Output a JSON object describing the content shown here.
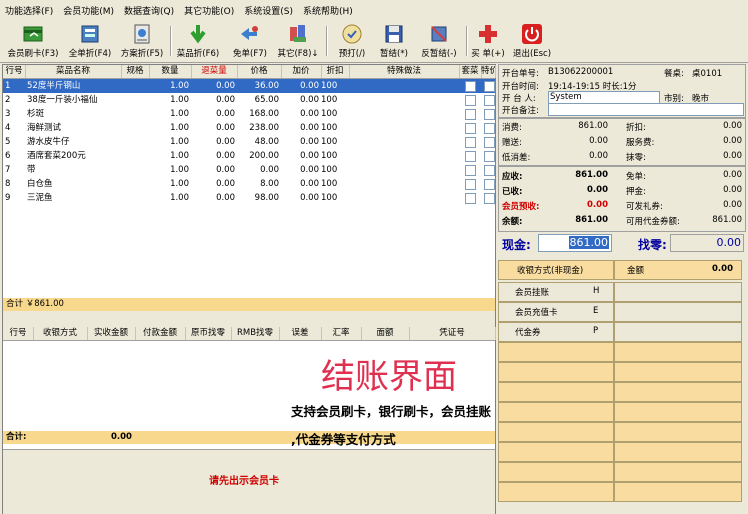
{
  "menu": [
    "功能选择(F)",
    "会员功能(M)",
    "数据查询(Q)",
    "其它功能(O)",
    "系统设置(S)",
    "系统帮助(H)"
  ],
  "toolbar": [
    {
      "label": "会员刷卡(F3)",
      "icon": "member-card-icon"
    },
    {
      "label": "全单折(F4)",
      "icon": "discount-all-icon"
    },
    {
      "label": "方案折(F5)",
      "icon": "plan-discount-icon"
    },
    {
      "label": "菜品折(F6)",
      "icon": "dish-discount-icon"
    },
    {
      "label": "免单(F7)",
      "icon": "free-order-icon"
    },
    {
      "label": "其它(F8)↓",
      "icon": "other-icon"
    },
    {
      "label": "预打(/)",
      "icon": "preprint-icon"
    },
    {
      "label": "暂结(*)",
      "icon": "save-icon"
    },
    {
      "label": "反暂结(-)",
      "icon": "reverse-icon"
    },
    {
      "label": "买 单(+)",
      "icon": "plus-icon"
    },
    {
      "label": "退出(Esc)",
      "icon": "power-icon"
    }
  ],
  "grid": {
    "headers": [
      "行号",
      "菜品名称",
      "规格",
      "数量",
      "退菜量",
      "价格",
      "加价",
      "折扣",
      "特殊做法",
      "套菜",
      "特价"
    ],
    "rows": [
      {
        "no": "1",
        "name": "52度半斤钢山",
        "spec": "",
        "qty": "1.00",
        "ret": "0.00",
        "price": "36.00",
        "add": "0.00",
        "disc": "100",
        "special": ""
      },
      {
        "no": "2",
        "name": "38度一斤装小福仙",
        "spec": "",
        "qty": "1.00",
        "ret": "0.00",
        "price": "65.00",
        "add": "0.00",
        "disc": "100",
        "special": ""
      },
      {
        "no": "3",
        "name": "杉斑",
        "spec": "",
        "qty": "1.00",
        "ret": "0.00",
        "price": "168.00",
        "add": "0.00",
        "disc": "100",
        "special": ""
      },
      {
        "no": "4",
        "name": "海鲜测试",
        "spec": "",
        "qty": "1.00",
        "ret": "0.00",
        "price": "238.00",
        "add": "0.00",
        "disc": "100",
        "special": ""
      },
      {
        "no": "5",
        "name": "游水皮牛仔",
        "spec": "",
        "qty": "1.00",
        "ret": "0.00",
        "price": "48.00",
        "add": "0.00",
        "disc": "100",
        "special": ""
      },
      {
        "no": "6",
        "name": "酒席套菜200元",
        "spec": "",
        "qty": "1.00",
        "ret": "0.00",
        "price": "200.00",
        "add": "0.00",
        "disc": "100",
        "special": ""
      },
      {
        "no": "7",
        "name": "带",
        "spec": "",
        "qty": "1.00",
        "ret": "0.00",
        "price": "0.00",
        "add": "0.00",
        "disc": "100",
        "special": ""
      },
      {
        "no": "8",
        "name": "白仓鱼",
        "spec": "",
        "qty": "1.00",
        "ret": "0.00",
        "price": "8.00",
        "add": "0.00",
        "disc": "100",
        "special": ""
      },
      {
        "no": "9",
        "name": "三泥鱼",
        "spec": "",
        "qty": "1.00",
        "ret": "0.00",
        "price": "98.00",
        "add": "0.00",
        "disc": "100",
        "special": ""
      }
    ],
    "total": "合计 ￥861.00"
  },
  "paygrid": {
    "headers": [
      "行号",
      "收银方式",
      "实收金额",
      "付款金额",
      "原币找零",
      "RMB找零",
      "误差",
      "汇率",
      "面额",
      "凭证号"
    ],
    "total_label": "合计:",
    "total_value": "0.00"
  },
  "promo": {
    "title": "结账界面",
    "line1": "支持会员刷卡，银行刷卡，会员挂账",
    "line2": ",代金券等支付方式"
  },
  "hint": "请先出示会员卡",
  "info": {
    "table_no_label": "开台单号:",
    "table_no": "B13062200001",
    "desk_label": "餐桌:",
    "desk": "桌0101",
    "time_label": "开台时间:",
    "time": "19:14-19:15 时长:1分",
    "opener_label": "开 台 人:",
    "opener": "System",
    "market_label": "市别:",
    "market": "晚市",
    "note_label": "开台备注:"
  },
  "summary": [
    {
      "l1": "消费:",
      "v1": "861.00",
      "l2": "折扣:",
      "v2": "0.00"
    },
    {
      "l1": "赠送:",
      "v1": "0.00",
      "l2": "服务费:",
      "v2": "0.00"
    },
    {
      "l1": "低消差:",
      "v1": "0.00",
      "l2": "抹零:",
      "v2": "0.00"
    }
  ],
  "due": [
    {
      "l1": "应收:",
      "v1": "861.00",
      "l2": "免单:",
      "v2": "0.00"
    },
    {
      "l1": "已收:",
      "v1": "0.00",
      "l2": "押金:",
      "v2": "0.00"
    },
    {
      "l1": "会员预收:",
      "v1": "0.00",
      "l2": "可发礼券:",
      "v2": "0.00"
    },
    {
      "l1": "余额:",
      "v1": "861.00",
      "l2": "可用代金券额:",
      "v2": "861.00"
    }
  ],
  "cash": {
    "label": "现金:",
    "value": "861.00",
    "change_label": "找零:",
    "change": "0.00"
  },
  "paymethods": {
    "header_label": "收银方式(非现金)",
    "header_amount_label": "金额",
    "header_amount": "0.00",
    "items": [
      {
        "name": "会员挂账",
        "key": "H"
      },
      {
        "name": "会员充值卡",
        "key": "E"
      },
      {
        "name": "代金券",
        "key": "P"
      }
    ]
  }
}
